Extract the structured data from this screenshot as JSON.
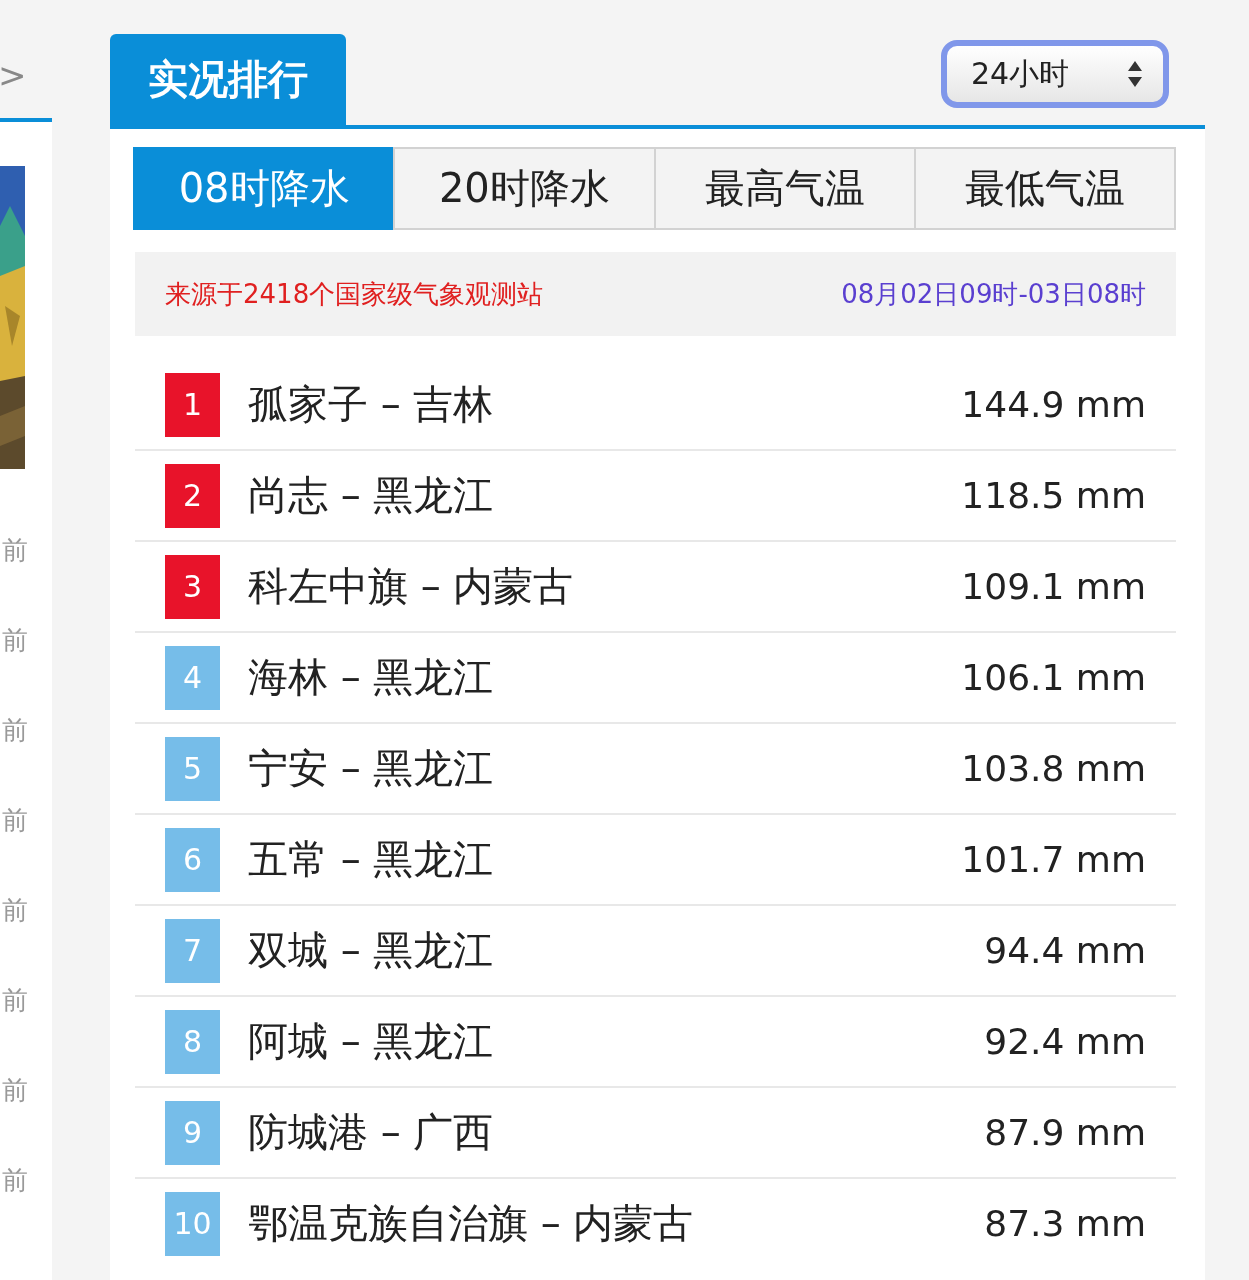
{
  "side_panel": {
    "arrow": ">",
    "items": [
      {
        "text": "前"
      },
      {
        "text": "前"
      },
      {
        "text": "前"
      },
      {
        "text": "前"
      },
      {
        "text": "前"
      },
      {
        "text": "前"
      },
      {
        "text": "前"
      },
      {
        "text": "前"
      }
    ]
  },
  "header": {
    "title": "实况排行",
    "period_select": {
      "value": "24小时"
    }
  },
  "tabs": [
    {
      "label": "08时降水",
      "selected": true
    },
    {
      "label": "20时降水",
      "selected": false
    },
    {
      "label": "最高气温",
      "selected": false
    },
    {
      "label": "最低气温",
      "selected": false
    }
  ],
  "info": {
    "source": "来源于2418个国家级气象观测站",
    "period": "08月02日09时-03日08时"
  },
  "ranking": [
    {
      "rank": "1",
      "color": "#e8132a",
      "station": "孤家子 – 吉林",
      "value": "144.9 mm"
    },
    {
      "rank": "2",
      "color": "#e8132a",
      "station": "尚志 – 黑龙江",
      "value": "118.5 mm"
    },
    {
      "rank": "3",
      "color": "#e8132a",
      "station": "科左中旗 – 内蒙古",
      "value": "109.1 mm"
    },
    {
      "rank": "4",
      "color": "#76bde9",
      "station": "海林 – 黑龙江",
      "value": "106.1 mm"
    },
    {
      "rank": "5",
      "color": "#76bde9",
      "station": "宁安 – 黑龙江",
      "value": "103.8 mm"
    },
    {
      "rank": "6",
      "color": "#76bde9",
      "station": "五常 – 黑龙江",
      "value": "101.7 mm"
    },
    {
      "rank": "7",
      "color": "#76bde9",
      "station": "双城 – 黑龙江",
      "value": "94.4 mm"
    },
    {
      "rank": "8",
      "color": "#76bde9",
      "station": "阿城 – 黑龙江",
      "value": "92.4 mm"
    },
    {
      "rank": "9",
      "color": "#76bde9",
      "station": "防城港 – 广西",
      "value": "87.9 mm"
    },
    {
      "rank": "10",
      "color": "#76bde9",
      "station": "鄂温克族自治旗 – 内蒙古",
      "value": "87.3 mm"
    }
  ]
}
